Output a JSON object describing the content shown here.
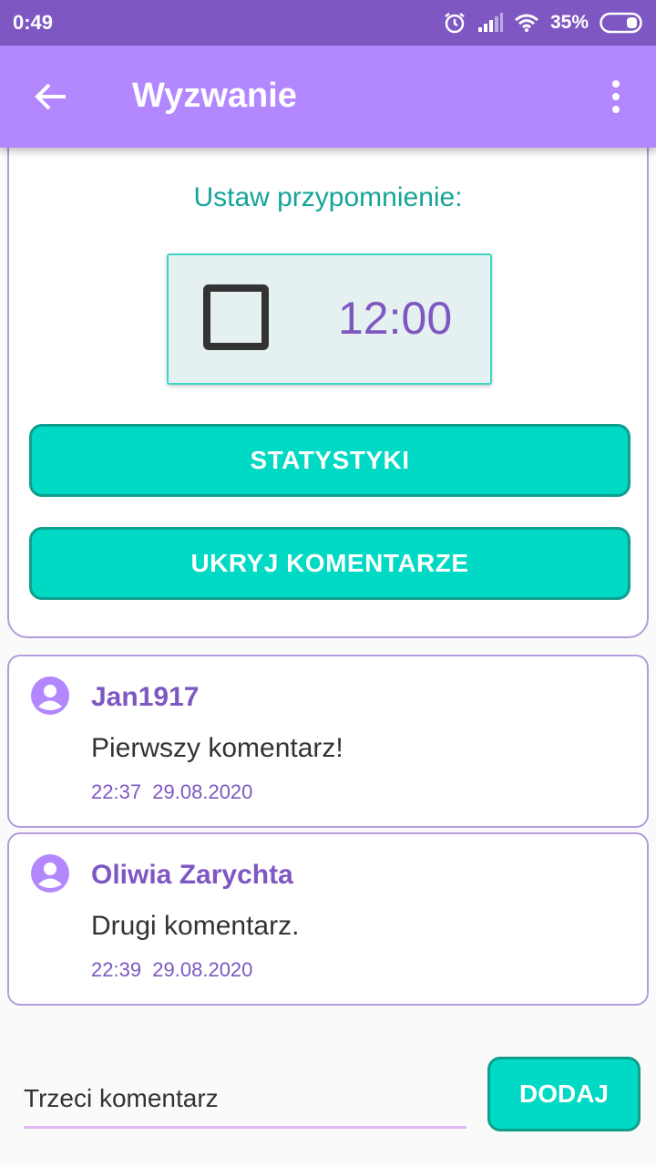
{
  "status_bar": {
    "time": "0:49",
    "battery_percent": "35%",
    "icons": [
      "alarm-icon",
      "signal-icon",
      "wifi-icon",
      "battery-icon"
    ]
  },
  "app_bar": {
    "title": "Wyzwanie",
    "back_icon": "arrow-back-icon",
    "menu_icon": "more-vert-icon",
    "color": "#b388ff"
  },
  "reminder": {
    "label": "Ustaw przypomnienie:",
    "checked": false,
    "time": "12:00"
  },
  "buttons": {
    "stats_label": "STATYSTYKI",
    "hide_comments_label": "UKRYJ KOMENTARZE",
    "add_label": "DODAJ",
    "color": "#00d9c4"
  },
  "comments": [
    {
      "author": "Jan1917",
      "text": "Pierwszy komentarz!",
      "time": "22:37",
      "date": "29.08.2020"
    },
    {
      "author": "Oliwia Zarychta",
      "text": "Drugi komentarz.",
      "time": "22:39",
      "date": "29.08.2020"
    }
  ],
  "new_comment": {
    "value": "Trzeci komentarz"
  },
  "colors": {
    "accent": "#7e57c2",
    "teal": "#16a497"
  }
}
